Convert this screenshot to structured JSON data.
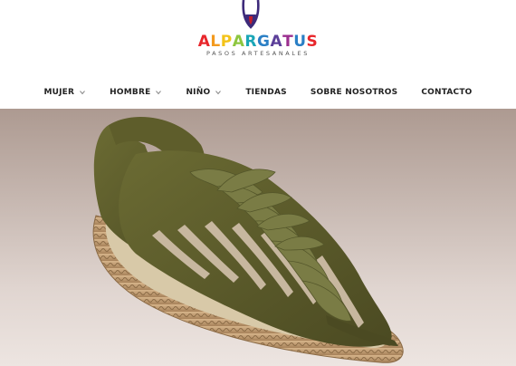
{
  "brand": {
    "name_letters": [
      "A",
      "L",
      "P",
      "A",
      "R",
      "G",
      "A",
      "T",
      "U",
      "S"
    ],
    "letter_colors": [
      "#e8262b",
      "#f39a1e",
      "#f3c31a",
      "#8dc63f",
      "#1aa6b7",
      "#2a7fc5",
      "#5b3f99",
      "#9b2f8f",
      "#2a7fc5",
      "#e8262b"
    ],
    "tagline": "PASOS ARTESANALES",
    "mark_color": "#3d2a7a",
    "accent_red": "#c41e2a"
  },
  "nav": {
    "items": [
      {
        "label": "MUJER",
        "has_dropdown": true
      },
      {
        "label": "HOMBRE",
        "has_dropdown": true
      },
      {
        "label": "NIÑO",
        "has_dropdown": true
      },
      {
        "label": "TIENDAS",
        "has_dropdown": false
      },
      {
        "label": "SOBRE NOSOTROS",
        "has_dropdown": false
      },
      {
        "label": "CONTACTO",
        "has_dropdown": false
      }
    ],
    "dropdown_icon": "chevron-down-icon"
  },
  "hero": {
    "subject": "olive-green-espadrille-sandal",
    "colors": {
      "suede": "#5a5a2a",
      "jute": "#c9a47a",
      "insole": "#d8c9a8"
    }
  }
}
